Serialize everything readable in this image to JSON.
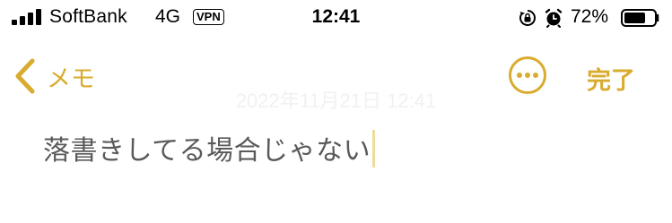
{
  "status_bar": {
    "carrier": "SoftBank",
    "network": "4G",
    "vpn": "VPN",
    "time": "12:41",
    "battery_percent": "72%",
    "battery_level": 0.72
  },
  "nav": {
    "back_label": "メモ",
    "done_label": "完了"
  },
  "note": {
    "date": "2022年11月21日 12:41",
    "text": "落書きしてる場合じゃない"
  },
  "colors": {
    "accent": "#d9ac2f",
    "body_text": "#5a5a5a"
  }
}
